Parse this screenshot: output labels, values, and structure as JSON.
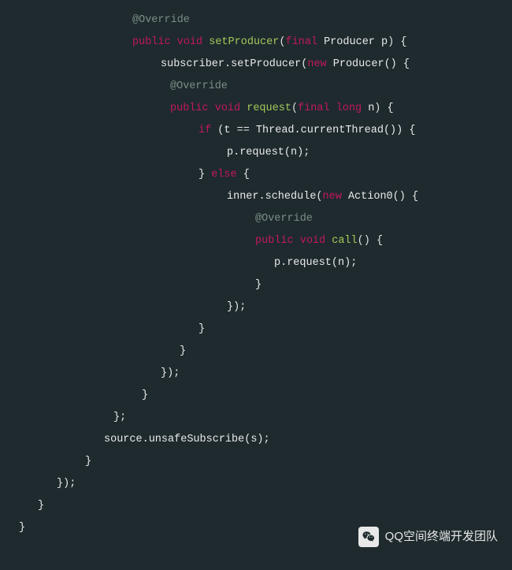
{
  "code": {
    "lines": [
      {
        "indent": 14,
        "segments": [
          {
            "cls": "anno",
            "t": "@Override"
          }
        ]
      },
      {
        "indent": 14,
        "segments": [
          {
            "cls": "kw",
            "t": "public"
          },
          {
            "cls": "",
            "t": " "
          },
          {
            "cls": "kw",
            "t": "void"
          },
          {
            "cls": "",
            "t": " "
          },
          {
            "cls": "fn",
            "t": "setProducer"
          },
          {
            "cls": "paren",
            "t": "("
          },
          {
            "cls": "kw",
            "t": "final"
          },
          {
            "cls": "",
            "t": " Producer p"
          },
          {
            "cls": "paren",
            "t": ")"
          },
          {
            "cls": "",
            "t": " {"
          }
        ]
      },
      {
        "indent": 17,
        "segments": [
          {
            "cls": "",
            "t": "subscriber.setProducer("
          },
          {
            "cls": "kw",
            "t": "new"
          },
          {
            "cls": "",
            "t": " Producer() {"
          }
        ]
      },
      {
        "indent": 18,
        "segments": [
          {
            "cls": "anno",
            "t": "@Override"
          }
        ]
      },
      {
        "indent": 18,
        "segments": [
          {
            "cls": "kw",
            "t": "public"
          },
          {
            "cls": "",
            "t": " "
          },
          {
            "cls": "kw",
            "t": "void"
          },
          {
            "cls": "",
            "t": " "
          },
          {
            "cls": "fn",
            "t": "request"
          },
          {
            "cls": "paren",
            "t": "("
          },
          {
            "cls": "kw",
            "t": "final"
          },
          {
            "cls": "",
            "t": " "
          },
          {
            "cls": "kw",
            "t": "long"
          },
          {
            "cls": "",
            "t": " n"
          },
          {
            "cls": "paren",
            "t": ")"
          },
          {
            "cls": "",
            "t": " {"
          }
        ]
      },
      {
        "indent": 21,
        "segments": [
          {
            "cls": "kw",
            "t": "if"
          },
          {
            "cls": "",
            "t": " (t == Thread.currentThread()) {"
          }
        ]
      },
      {
        "indent": 24,
        "segments": [
          {
            "cls": "",
            "t": "p.request(n);"
          }
        ]
      },
      {
        "indent": 21,
        "segments": [
          {
            "cls": "",
            "t": "} "
          },
          {
            "cls": "kw",
            "t": "else"
          },
          {
            "cls": "",
            "t": " {"
          }
        ]
      },
      {
        "indent": 24,
        "segments": [
          {
            "cls": "",
            "t": "inner.schedule("
          },
          {
            "cls": "kw",
            "t": "new"
          },
          {
            "cls": "",
            "t": " Action0() {"
          }
        ]
      },
      {
        "indent": 27,
        "segments": [
          {
            "cls": "anno",
            "t": "@Override"
          }
        ]
      },
      {
        "indent": 27,
        "segments": [
          {
            "cls": "kw",
            "t": "public"
          },
          {
            "cls": "",
            "t": " "
          },
          {
            "cls": "kw",
            "t": "void"
          },
          {
            "cls": "",
            "t": " "
          },
          {
            "cls": "fn",
            "t": "call"
          },
          {
            "cls": "paren",
            "t": "()"
          },
          {
            "cls": "",
            "t": " {"
          }
        ]
      },
      {
        "indent": 29,
        "segments": [
          {
            "cls": "",
            "t": "p.request(n);"
          }
        ]
      },
      {
        "indent": 27,
        "segments": [
          {
            "cls": "",
            "t": "}"
          }
        ]
      },
      {
        "indent": 24,
        "segments": [
          {
            "cls": "",
            "t": "});"
          }
        ]
      },
      {
        "indent": 21,
        "segments": [
          {
            "cls": "",
            "t": "}"
          }
        ]
      },
      {
        "indent": 19,
        "segments": [
          {
            "cls": "",
            "t": "}"
          }
        ]
      },
      {
        "indent": 17,
        "segments": [
          {
            "cls": "",
            "t": "});"
          }
        ]
      },
      {
        "indent": 15,
        "segments": [
          {
            "cls": "",
            "t": "}"
          }
        ]
      },
      {
        "indent": 12,
        "segments": [
          {
            "cls": "",
            "t": "};"
          }
        ]
      },
      {
        "indent": 0,
        "segments": [
          {
            "cls": "",
            "t": ""
          }
        ]
      },
      {
        "indent": 11,
        "segments": [
          {
            "cls": "",
            "t": "source.unsafeSubscribe(s);"
          }
        ]
      },
      {
        "indent": 9,
        "segments": [
          {
            "cls": "",
            "t": "}"
          }
        ]
      },
      {
        "indent": 6,
        "segments": [
          {
            "cls": "",
            "t": "});"
          }
        ]
      },
      {
        "indent": 4,
        "segments": [
          {
            "cls": "",
            "t": "}"
          }
        ]
      },
      {
        "indent": 2,
        "segments": [
          {
            "cls": "",
            "t": "}"
          }
        ]
      }
    ]
  },
  "watermark": {
    "text": "QQ空间终端开发团队"
  }
}
